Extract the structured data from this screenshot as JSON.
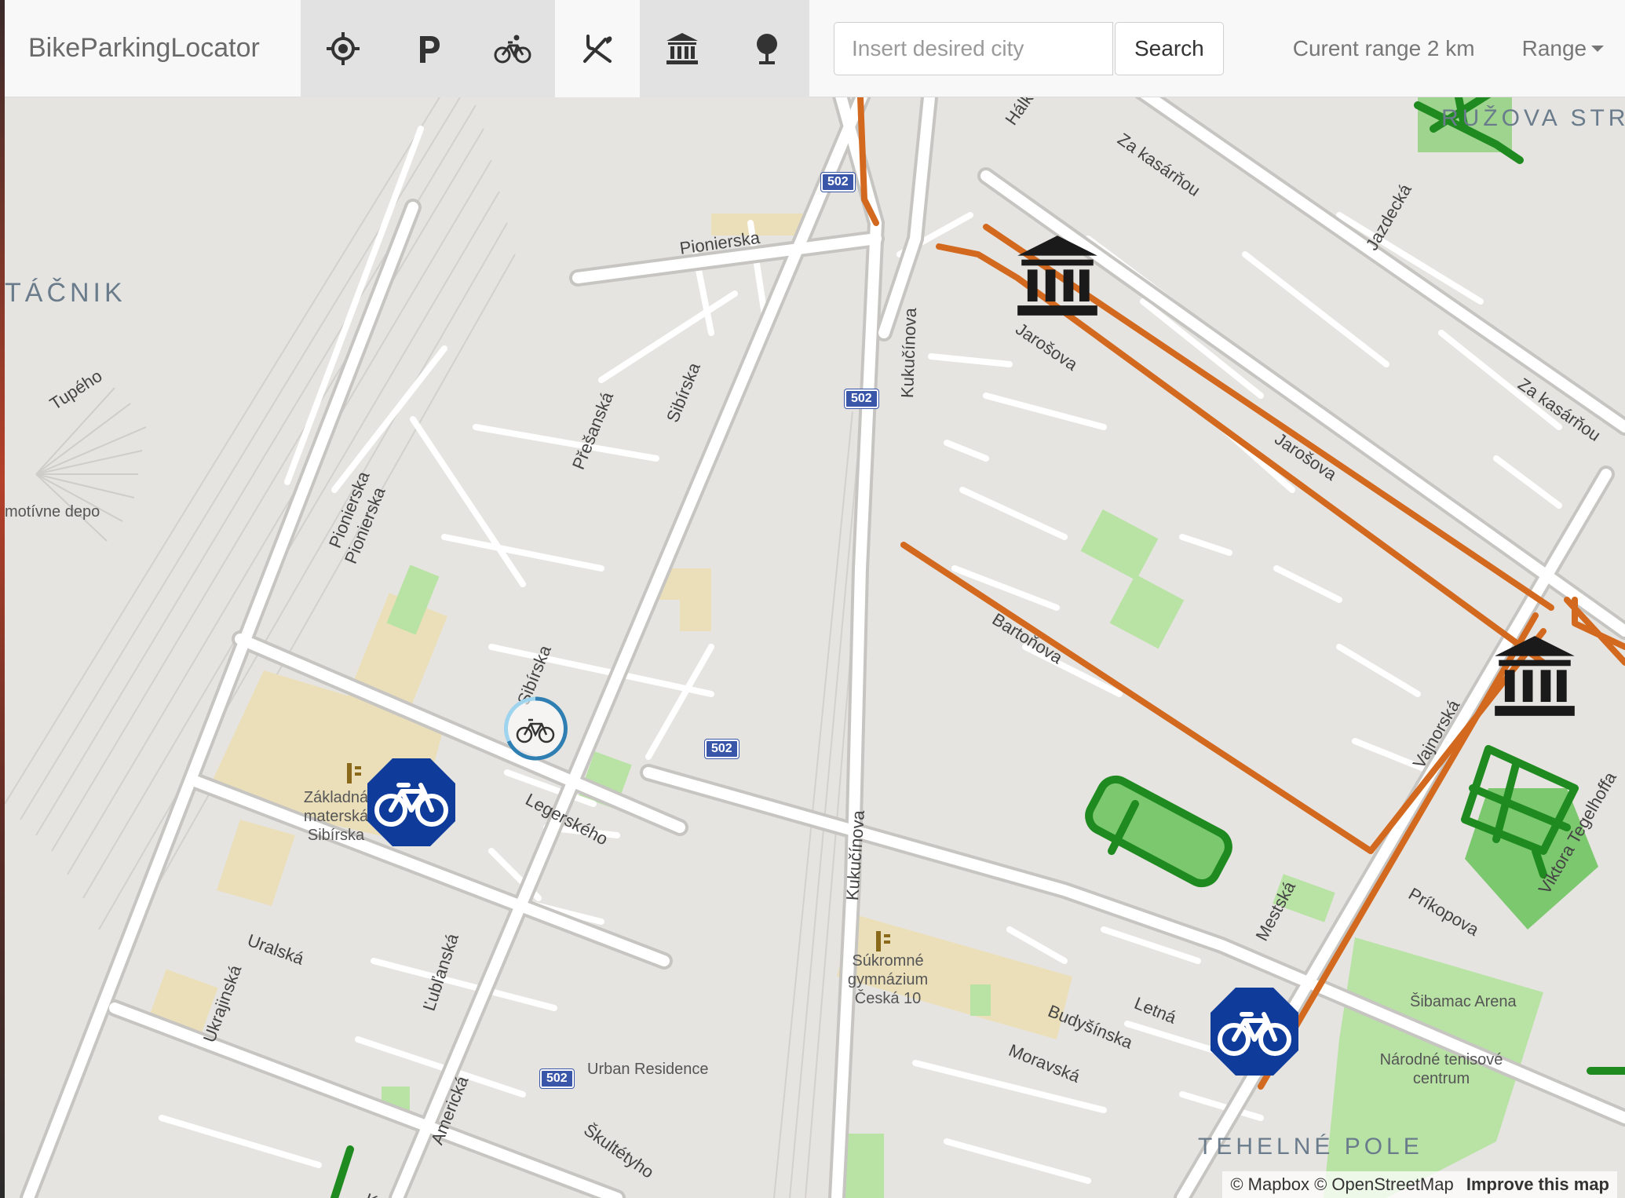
{
  "app": {
    "title": "BikeParkingLocator"
  },
  "toolbar": {
    "icons": [
      {
        "name": "location-icon",
        "active": true
      },
      {
        "name": "parking-icon",
        "active": true
      },
      {
        "name": "bicycle-icon",
        "active": true
      },
      {
        "name": "restaurant-icon",
        "active": false
      },
      {
        "name": "museum-icon",
        "active": true
      },
      {
        "name": "park-tree-icon",
        "active": true
      }
    ]
  },
  "search": {
    "placeholder": "Insert desired city",
    "button_label": "Search"
  },
  "range": {
    "current_text": "Curent range 2 km",
    "dropdown_label": "Range"
  },
  "map": {
    "districts": [
      "TÁČNIK",
      "RUŽOVA STRÁŇ",
      "TEHELNÉ POLE"
    ],
    "roads": [
      "Pionierska",
      "Tupého",
      "Sibírska",
      "Přešanská",
      "Pionierska",
      "Sibírska",
      "Legerského",
      "Kukučínova",
      "Kukučínova",
      "Jarošova",
      "Jarošova",
      "Hálková",
      "Za kasárňou",
      "Za kasárňou",
      "Jazdecká",
      "Vajnorská",
      "Bartoňova",
      "Mestská",
      "Viktora Tegelhoffa",
      "Príkopova",
      "Budyšínska",
      "Uralská",
      "Ukrajinská",
      "Ľubľanská",
      "Americká",
      "Kraskova",
      "Škultétyho",
      "Pionierska",
      "Moravská",
      "Letná"
    ],
    "route_shields": [
      "502",
      "502",
      "502",
      "502"
    ],
    "pois": [
      "motívne depo",
      "Základná materská Sibírska",
      "Súkromné gymnázium Česká 10",
      "Urban Residence",
      "Šibamac Arena",
      "Národné tenisové centrum"
    ],
    "attribution": {
      "mapbox": "© Mapbox",
      "osm": "© OpenStreetMap",
      "improve": "Improve this map"
    }
  },
  "colors": {
    "cycleway": "#d2691e",
    "park_outline": "#1f8a1f",
    "park_fill": "#7cc86e",
    "marker_blue": "#0f3c9b",
    "museum": "#1a1a1a",
    "navbar": "#f8f8f8"
  }
}
